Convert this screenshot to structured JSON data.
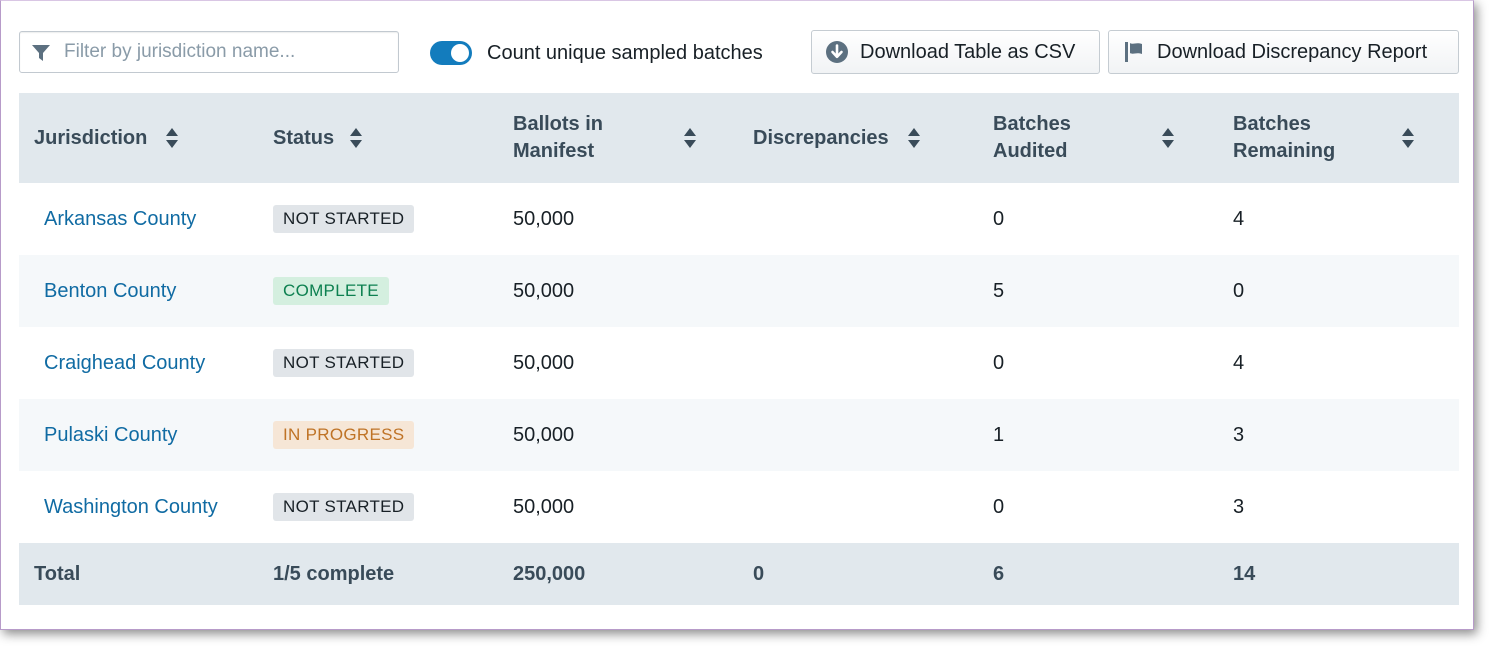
{
  "filter": {
    "placeholder": "Filter by jurisdiction name...",
    "value": ""
  },
  "toggle": {
    "label": "Count unique sampled batches",
    "checked": true
  },
  "buttons": {
    "download_csv": "Download Table as CSV",
    "download_discrepancy": "Download Discrepancy Report"
  },
  "icons": {
    "filter": "filter-icon",
    "download": "arrow-down-circle-icon",
    "flag": "flag-icon",
    "sort": "double-caret-icon"
  },
  "colors": {
    "accent": "#137cbd",
    "link": "#106ba3",
    "header_bg": "#e1e8ed",
    "complete": "#0d8050",
    "in_progress": "#bf7326"
  },
  "table": {
    "columns": [
      "Jurisdiction",
      "Status",
      "Ballots in Manifest",
      "Discrepancies",
      "Batches Audited",
      "Batches Remaining"
    ],
    "rows": [
      {
        "jurisdiction": "Arkansas County",
        "status": "NOT STARTED",
        "status_kind": "not-started",
        "ballots": "50,000",
        "discrepancies": "",
        "audited": "0",
        "remaining": "4"
      },
      {
        "jurisdiction": "Benton County",
        "status": "COMPLETE",
        "status_kind": "complete",
        "ballots": "50,000",
        "discrepancies": "",
        "audited": "5",
        "remaining": "0"
      },
      {
        "jurisdiction": "Craighead County",
        "status": "NOT STARTED",
        "status_kind": "not-started",
        "ballots": "50,000",
        "discrepancies": "",
        "audited": "0",
        "remaining": "4"
      },
      {
        "jurisdiction": "Pulaski County",
        "status": "IN PROGRESS",
        "status_kind": "in-progress",
        "ballots": "50,000",
        "discrepancies": "",
        "audited": "1",
        "remaining": "3"
      },
      {
        "jurisdiction": "Washington County",
        "status": "NOT STARTED",
        "status_kind": "not-started",
        "ballots": "50,000",
        "discrepancies": "",
        "audited": "0",
        "remaining": "3"
      }
    ],
    "total": {
      "label": "Total",
      "status": "1/5 complete",
      "ballots": "250,000",
      "discrepancies": "0",
      "audited": "6",
      "remaining": "14"
    }
  }
}
